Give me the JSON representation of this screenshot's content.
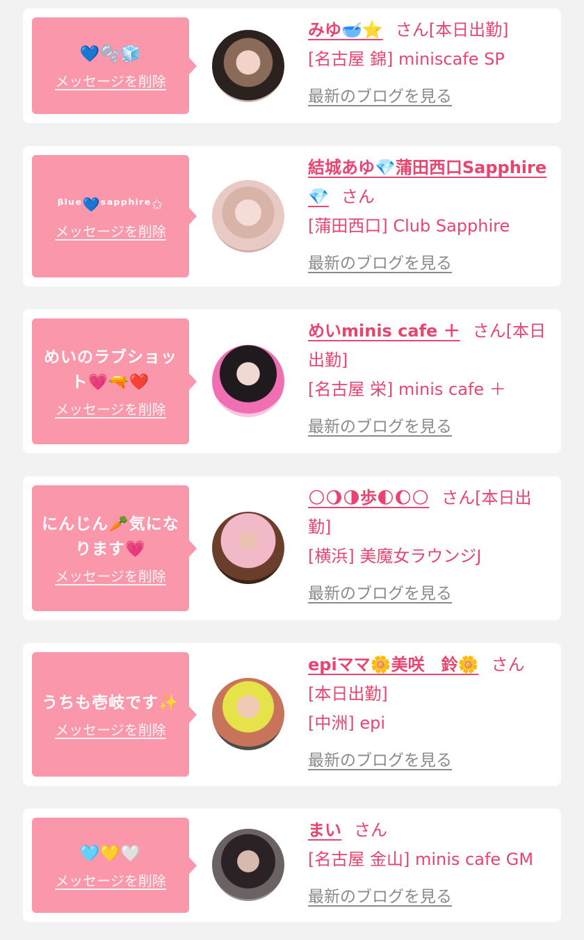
{
  "messages": [
    {
      "message": "💙🫧🧊",
      "delete_label": "メッセージを削除",
      "name": "みゆ🥣⭐️",
      "honorific": "さん",
      "status": "[本日出勤]",
      "shop": "[名古屋 錦] miniscafe SP",
      "blog_label": "最新のブログを見る"
    },
    {
      "message": "ᵝˡᵘᵉ💙ˢᵃᵖᵖʰⁱʳᵉ✩",
      "delete_label": "メッセージを削除",
      "name": "結城あゆ💎蒲田西口Sapphire💎",
      "honorific": "さん",
      "status": "",
      "shop": "[蒲田西口] Club Sapphire",
      "blog_label": "最新のブログを見る"
    },
    {
      "message": "めいのラブショット💗🔫❤️",
      "delete_label": "メッセージを削除",
      "name": "めいminis cafe ＋",
      "honorific": "さん",
      "status": "[本日出勤]",
      "shop": "[名古屋 栄] minis cafe ＋",
      "blog_label": "最新のブログを見る"
    },
    {
      "message": "にんじん🥕気になります💗",
      "delete_label": "メッセージを削除",
      "name": "🌕🌖🌗歩🌓🌔🌕",
      "honorific": "さん",
      "status": "[本日出勤]",
      "shop": "[横浜] 美魔女ラウンジJ",
      "blog_label": "最新のブログを見る"
    },
    {
      "message": "うちも壱岐です✨",
      "delete_label": "メッセージを削除",
      "name": "epiママ🌼美咲　鈴🌼",
      "honorific": "さん",
      "status": "[本日出勤]",
      "shop": "[中洲] epi",
      "blog_label": "最新のブログを見る"
    },
    {
      "message": "🩵💛🤍",
      "delete_label": "メッセージを削除",
      "name": "まい",
      "honorific": "さん",
      "status": "",
      "shop": "[名古屋 金山] minis cafe GM",
      "blog_label": "最新のブログを見る"
    }
  ],
  "colors": {
    "accent_pink": "#fb97ab",
    "name_pink": "#e6456f",
    "link_gray": "#8a8a8a",
    "page_bg": "#f2f2f2",
    "card_bg": "#ffffff"
  }
}
